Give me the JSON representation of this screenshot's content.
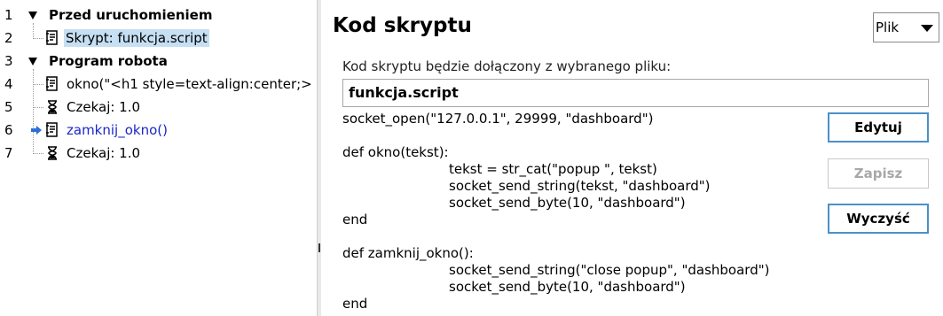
{
  "tree": {
    "rows": [
      {
        "num": "1",
        "label": "Przed uruchomieniem",
        "kind": "section"
      },
      {
        "num": "2",
        "label": "Skrypt: funkcja.script",
        "kind": "script",
        "selected": true
      },
      {
        "num": "3",
        "label": "Program robota",
        "kind": "section"
      },
      {
        "num": "4",
        "label": "okno(\"<h1 style=text-align:center;>",
        "kind": "script"
      },
      {
        "num": "5",
        "label": "Czekaj: 1.0",
        "kind": "wait"
      },
      {
        "num": "6",
        "label": "zamknij_okno()",
        "kind": "script",
        "current": true
      },
      {
        "num": "7",
        "label": "Czekaj: 1.0",
        "kind": "wait"
      }
    ]
  },
  "panel": {
    "title": "Kod skryptu",
    "file_select": "Plik",
    "description": "Kod skryptu będzie dołączony z wybranego pliku:",
    "file_name": "funkcja.script",
    "code_lines": [
      {
        "text": "socket_open(\"127.0.0.1\", 29999, \"dashboard\")",
        "indent": false
      },
      {
        "text": "",
        "indent": false
      },
      {
        "text": "def okno(tekst):",
        "indent": false
      },
      {
        "text": "tekst = str_cat(\"popup \", tekst)",
        "indent": true
      },
      {
        "text": "socket_send_string(tekst, \"dashboard\")",
        "indent": true
      },
      {
        "text": "socket_send_byte(10, \"dashboard\")",
        "indent": true
      },
      {
        "text": "end",
        "indent": false
      },
      {
        "text": "",
        "indent": false
      },
      {
        "text": "def zamknij_okno():",
        "indent": false
      },
      {
        "text": "socket_send_string(\"close popup\", \"dashboard\")",
        "indent": true
      },
      {
        "text": "socket_send_byte(10, \"dashboard\")",
        "indent": true
      },
      {
        "text": "end",
        "indent": false
      }
    ],
    "buttons": {
      "edit": "Edytuj",
      "save": "Zapisz",
      "clear": "Wyczyść"
    }
  },
  "colors": {
    "selection": "#c6dff3",
    "current_node": "#1a27c9",
    "button_border": "#4a90c9"
  }
}
